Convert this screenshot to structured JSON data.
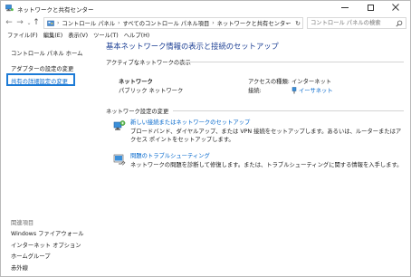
{
  "window": {
    "title": "ネットワークと共有センター"
  },
  "address": {
    "crumbs": [
      "コントロール パネル",
      "すべてのコントロール パネル項目",
      "ネットワークと共有センター"
    ],
    "search_placeholder": "コントロール パネルの検索"
  },
  "menu": [
    "ファイル(F)",
    "編集(E)",
    "表示(V)",
    "ツール(T)",
    "ヘルプ(H)"
  ],
  "sidebar": {
    "home": "コントロール パネル ホーム",
    "adapter": "アダプターの設定の変更",
    "advanced": "共有の詳細設定の変更",
    "related_title": "関連項目",
    "related": [
      "Windows ファイアウォール",
      "インターネット オプション",
      "ホームグループ",
      "赤外線"
    ]
  },
  "main": {
    "title": "基本ネットワーク情報の表示と接続のセットアップ",
    "active_label": "アクティブなネットワークの表示",
    "network_name": "ネットワーク",
    "network_type": "パブリック ネットワーク",
    "access_type_label": "アクセスの種類:",
    "access_type_value": "インターネット",
    "connection_label": "接続:",
    "connection_value": "イーサネット",
    "change_label": "ネットワーク設定の変更",
    "task1_link": "新しい接続またはネットワークのセットアップ",
    "task1_desc": "ブロードバンド、ダイヤルアップ、または VPN 接続をセットアップします。あるいは、ルーターまたはアクセス ポイントをセットアップします。",
    "task2_link": "問題のトラブルシューティング",
    "task2_desc": "ネットワークの問題を診断して修復します。または、トラブルシューティングに関する情報を入手します。"
  },
  "colors": {
    "link": "#0066cc",
    "title": "#1c3f94",
    "highlight": "#1d7bd6"
  }
}
